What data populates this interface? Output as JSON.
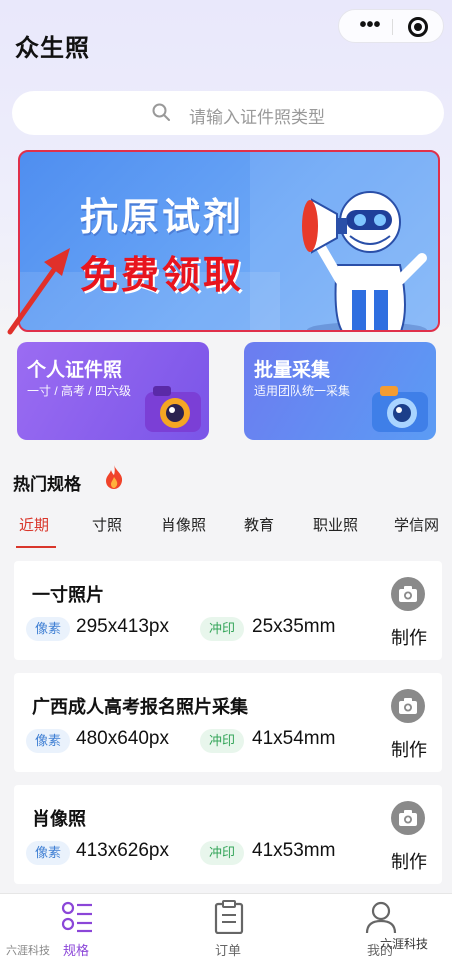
{
  "header": {
    "title": "众生照"
  },
  "search": {
    "placeholder": "请输入证件照类型"
  },
  "banner": {
    "line1": "抗原试剂",
    "line2": "免费领取"
  },
  "cards": [
    {
      "title": "个人证件照",
      "subtitle": "一寸 / 高考 / 四六级"
    },
    {
      "title": "批量采集",
      "subtitle": "适用团队统一采集"
    }
  ],
  "section": {
    "title": "热门规格"
  },
  "tabs": [
    "近期",
    "寸照",
    "肖像照",
    "教育",
    "职业照",
    "学信网"
  ],
  "items": [
    {
      "name": "一寸照片",
      "pixel_label": "像素",
      "pixel": "295x413px",
      "print_label": "冲印",
      "print": "25x35mm",
      "action": "制作"
    },
    {
      "name": "广西成人高考报名照片采集",
      "pixel_label": "像素",
      "pixel": "480x640px",
      "print_label": "冲印",
      "print": "41x54mm",
      "action": "制作"
    },
    {
      "name": "肖像照",
      "pixel_label": "像素",
      "pixel": "413x626px",
      "print_label": "冲印",
      "print": "41x53mm",
      "action": "制作"
    }
  ],
  "tabbar": [
    {
      "label": "规格",
      "active": true
    },
    {
      "label": "订单",
      "active": false
    },
    {
      "label": "我的",
      "active": false
    }
  ],
  "watermark": {
    "left": "六涯科技",
    "right": "六涯科技"
  },
  "colors": {
    "accent": "#d9362b",
    "tab_active": "#8b46d8",
    "banner_border": "#e0304a"
  }
}
